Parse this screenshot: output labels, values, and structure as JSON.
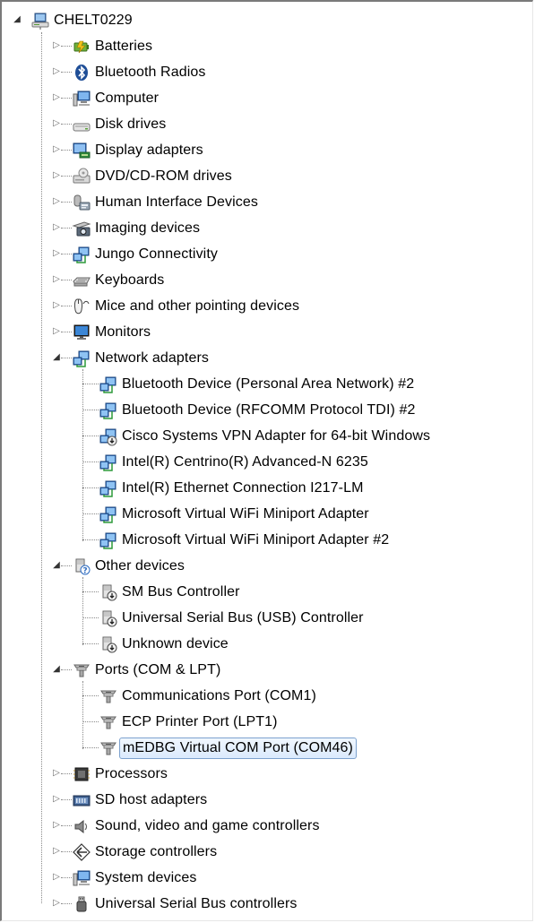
{
  "root": {
    "label": "CHELT0229",
    "icon": "computer-network-icon"
  },
  "categories": [
    {
      "label": "Batteries",
      "icon": "battery-icon",
      "expanded": false,
      "children": []
    },
    {
      "label": "Bluetooth Radios",
      "icon": "bluetooth-icon",
      "expanded": false,
      "children": []
    },
    {
      "label": "Computer",
      "icon": "computer-icon",
      "expanded": false,
      "children": []
    },
    {
      "label": "Disk drives",
      "icon": "disk-drive-icon",
      "expanded": false,
      "children": []
    },
    {
      "label": "Display adapters",
      "icon": "display-adapter-icon",
      "expanded": false,
      "children": []
    },
    {
      "label": "DVD/CD-ROM drives",
      "icon": "dvd-drive-icon",
      "expanded": false,
      "children": []
    },
    {
      "label": "Human Interface Devices",
      "icon": "hid-icon",
      "expanded": false,
      "children": []
    },
    {
      "label": "Imaging devices",
      "icon": "imaging-device-icon",
      "expanded": false,
      "children": []
    },
    {
      "label": "Jungo Connectivity",
      "icon": "network-icon",
      "expanded": false,
      "children": []
    },
    {
      "label": "Keyboards",
      "icon": "keyboard-icon",
      "expanded": false,
      "children": []
    },
    {
      "label": "Mice and other pointing devices",
      "icon": "mouse-icon",
      "expanded": false,
      "children": []
    },
    {
      "label": "Monitors",
      "icon": "monitor-icon",
      "expanded": false,
      "children": []
    },
    {
      "label": "Network adapters",
      "icon": "network-icon",
      "expanded": true,
      "children": [
        {
          "label": "Bluetooth Device (Personal Area Network) #2",
          "icon": "network-icon"
        },
        {
          "label": "Bluetooth Device (RFCOMM Protocol TDI) #2",
          "icon": "network-icon"
        },
        {
          "label": "Cisco Systems VPN Adapter for 64-bit Windows",
          "icon": "network-disabled-icon"
        },
        {
          "label": "Intel(R) Centrino(R) Advanced-N 6235",
          "icon": "network-icon"
        },
        {
          "label": "Intel(R) Ethernet Connection I217-LM",
          "icon": "network-icon"
        },
        {
          "label": "Microsoft Virtual WiFi Miniport Adapter",
          "icon": "network-icon"
        },
        {
          "label": "Microsoft Virtual WiFi Miniport Adapter #2",
          "icon": "network-icon"
        }
      ]
    },
    {
      "label": "Other devices",
      "icon": "unknown-device-icon",
      "expanded": true,
      "children": [
        {
          "label": "SM Bus Controller",
          "icon": "unknown-device-warning-icon"
        },
        {
          "label": "Universal Serial Bus (USB) Controller",
          "icon": "unknown-device-warning-icon"
        },
        {
          "label": "Unknown device",
          "icon": "unknown-device-warning-icon"
        }
      ]
    },
    {
      "label": "Ports (COM & LPT)",
      "icon": "port-icon",
      "expanded": true,
      "children": [
        {
          "label": "Communications Port (COM1)",
          "icon": "port-icon"
        },
        {
          "label": "ECP Printer Port (LPT1)",
          "icon": "port-icon"
        },
        {
          "label": "mEDBG Virtual COM Port (COM46)",
          "icon": "port-icon",
          "selected": true
        }
      ]
    },
    {
      "label": "Processors",
      "icon": "processor-icon",
      "expanded": false,
      "children": []
    },
    {
      "label": "SD host adapters",
      "icon": "sd-adapter-icon",
      "expanded": false,
      "children": []
    },
    {
      "label": "Sound, video and game controllers",
      "icon": "speaker-icon",
      "expanded": false,
      "children": []
    },
    {
      "label": "Storage controllers",
      "icon": "storage-controller-icon",
      "expanded": false,
      "children": []
    },
    {
      "label": "System devices",
      "icon": "computer-icon",
      "expanded": false,
      "children": []
    },
    {
      "label": "Universal Serial Bus controllers",
      "icon": "usb-icon",
      "expanded": false,
      "children": []
    }
  ],
  "colors": {
    "selection_border": "#7da2ce",
    "selection_fill": "#dbeafd",
    "dotted_line": "#8a8a8a"
  }
}
